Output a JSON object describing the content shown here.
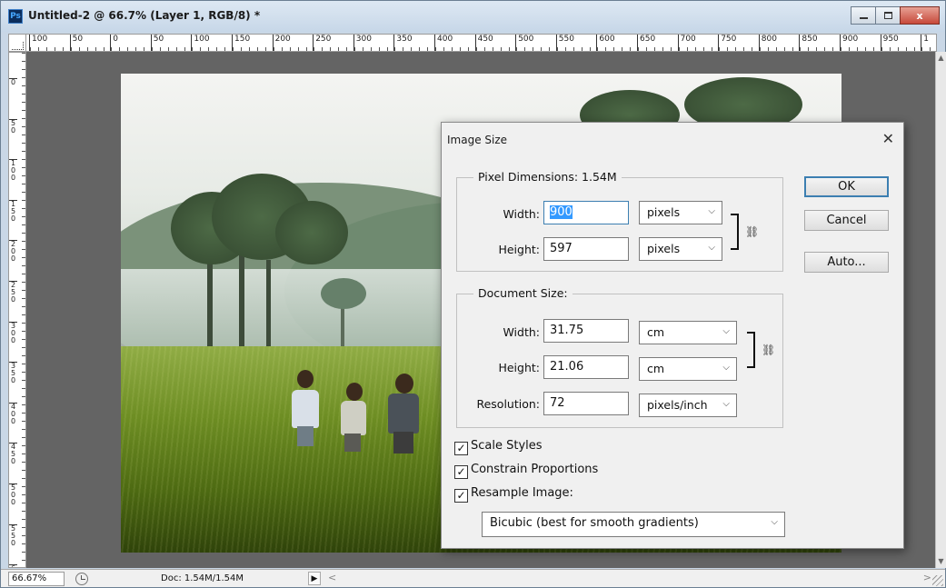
{
  "window": {
    "app_icon_text": "Ps",
    "title": "Untitled-2 @ 66.7% (Layer 1, RGB/8) *",
    "controls": {
      "close": "x"
    }
  },
  "rulers": {
    "horizontal": [
      "100",
      "50",
      "0",
      "50",
      "100",
      "150",
      "200",
      "250",
      "300",
      "350",
      "400",
      "450",
      "500",
      "550",
      "600",
      "650",
      "700",
      "750",
      "800",
      "850",
      "900",
      "950",
      "1"
    ],
    "vertical": [
      "0",
      "50",
      "100",
      "150",
      "200",
      "250",
      "300",
      "350",
      "400",
      "450",
      "500",
      "550",
      "6"
    ]
  },
  "dialog": {
    "title": "Image Size",
    "close": "✕",
    "pixel_dimensions": {
      "legend": "Pixel Dimensions:  1.54M",
      "width_label": "Width:",
      "width_value": "900",
      "width_unit": "pixels",
      "height_label": "Height:",
      "height_value": "597",
      "height_unit": "pixels"
    },
    "document_size": {
      "legend": "Document Size:",
      "width_label": "Width:",
      "width_value": "31.75",
      "width_unit": "cm",
      "height_label": "Height:",
      "height_value": "21.06",
      "height_unit": "cm",
      "resolution_label": "Resolution:",
      "resolution_value": "72",
      "resolution_unit": "pixels/inch"
    },
    "buttons": {
      "ok": "OK",
      "cancel": "Cancel",
      "auto": "Auto..."
    },
    "checkboxes": [
      {
        "label": "Scale Styles",
        "checked": true
      },
      {
        "label": "Constrain Proportions",
        "checked": true
      },
      {
        "label": "Resample Image:",
        "checked": true
      }
    ],
    "resample_method": "Bicubic (best for smooth gradients)"
  },
  "statusbar": {
    "zoom": "66.67%",
    "doc": "Doc: 1.54M/1.54M"
  }
}
